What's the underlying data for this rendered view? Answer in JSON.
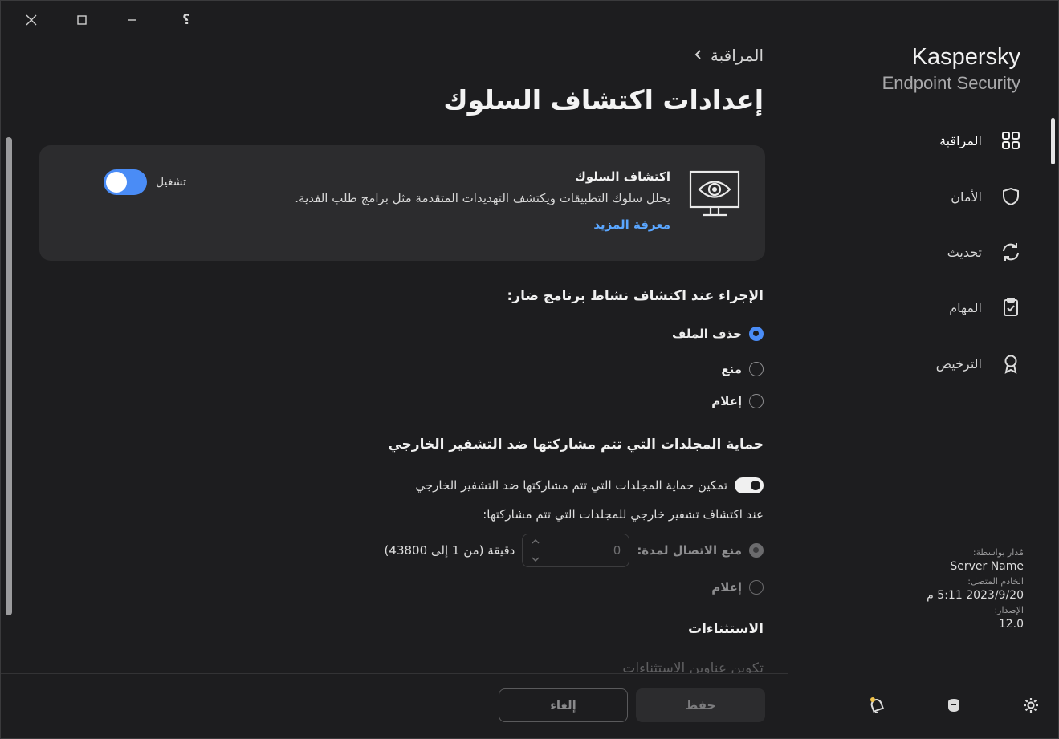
{
  "titlebar": {
    "close_icon": "close-icon",
    "maximize_icon": "maximize-icon",
    "minimize_icon": "minimize-icon",
    "help_icon": "help-icon",
    "help_glyph": "؟"
  },
  "sidebar": {
    "brand_line1": "Kaspersky",
    "brand_line2": "Endpoint Security",
    "items": [
      {
        "label": "المراقبة",
        "icon": "grid-icon",
        "active": true
      },
      {
        "label": "الأمان",
        "icon": "shield-icon",
        "active": false
      },
      {
        "label": "تحديث",
        "icon": "refresh-icon",
        "active": false
      },
      {
        "label": "المهام",
        "icon": "clipboard-check-icon",
        "active": false
      },
      {
        "label": "الترخيص",
        "icon": "award-icon",
        "active": false
      }
    ],
    "meta": {
      "managed_by_label": "مُدار بواسطة:",
      "managed_by_value": "Server Name",
      "connected_label": "الخادم المتصل:",
      "connected_value": "2023/9/20 5:11 م",
      "version_label": "الإصدار:",
      "version_value": "12.0"
    },
    "bottom_icons": [
      "notifications-icon",
      "support-icon",
      "settings-icon"
    ]
  },
  "main": {
    "breadcrumb": "المراقبة",
    "title": "إعدادات اكتشاف السلوك",
    "card": {
      "title": "اكتشاف السلوك",
      "description": "يحلل سلوك التطبيقات ويكتشف التهديدات المتقدمة مثل برامج طلب الفدية.",
      "link": "معرفة المزيد",
      "toggle_label": "تشغيل",
      "toggle_on": true
    },
    "action_section": {
      "title": "الإجراء عند اكتشاف نشاط برنامج ضار:",
      "options": [
        {
          "label": "حذف الملف",
          "checked": true
        },
        {
          "label": "منع",
          "checked": false
        },
        {
          "label": "إعلام",
          "checked": false
        }
      ]
    },
    "shared_section": {
      "title": "حماية المجلدات التي تتم مشاركتها ضد التشفير الخارجي",
      "toggle_label": "تمكين حماية المجلدات التي تتم مشاركتها ضد التشفير الخارجي",
      "toggle_on": true,
      "detect_text": "عند اكتشاف تشفير خارجي للمجلدات التي تتم مشاركتها:",
      "block_label": "منع الاتصال لمدة:",
      "block_value": "0",
      "block_suffix": "دقيقة (من 1 إلى 43800)",
      "notify_label": "إعلام"
    },
    "exclusions": {
      "title": "الاستثناءات",
      "partial_text": "تكوين عناوين الاستثناءات"
    },
    "buttons": {
      "save": "حفظ",
      "cancel": "إلغاء"
    }
  }
}
